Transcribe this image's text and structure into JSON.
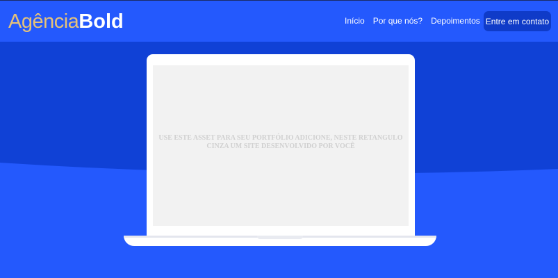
{
  "brand": {
    "light": "Agência",
    "bold": "Bold"
  },
  "nav": {
    "items": [
      "Início",
      "Por que nós?",
      "Depoimentos"
    ],
    "cta_label": "Entre em contato"
  },
  "hero": {
    "placeholder_text": "USE ESTE ASSET PARA SEU PORTFÓLIO ADICIONE, NESTE RETANGULO CINZA UM SITE DESENVOLVIDO POR VOCÊ"
  },
  "colors": {
    "primary": "#2459fd",
    "dark_band": "#1041d6",
    "cta": "#0f3bc8",
    "logo_accent": "#e6c27a",
    "screen": "#f2f2f2"
  }
}
